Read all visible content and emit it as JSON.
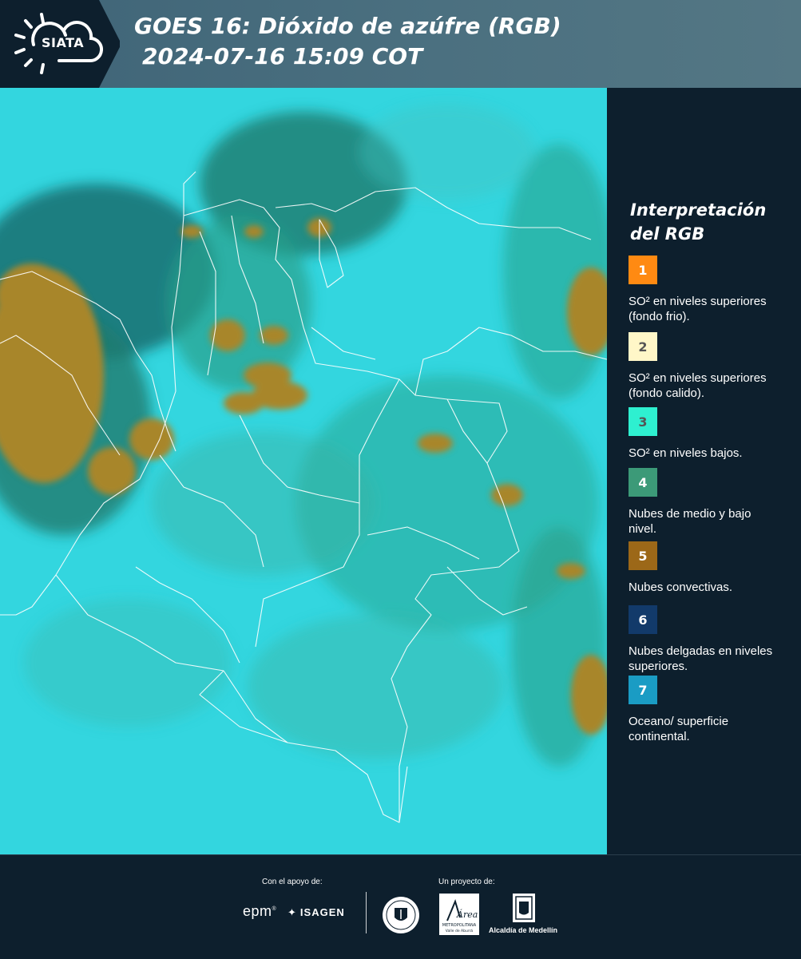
{
  "header": {
    "logo_text": "SIATA",
    "title_line1": "GOES 16: Dióxido de azúfre (RGB)",
    "title_line2": "2024-07-16 15:09 COT"
  },
  "map": {
    "base_color": "#33d6df",
    "landcover_color": "#3aa99a",
    "convective_color": "#a8862a",
    "border_color": "#ffffff"
  },
  "legend": {
    "title": "Interpretación del RGB",
    "items": [
      {
        "number": "1",
        "label": "SO² en niveles superiores (fondo frio).",
        "color": "#ff8a12",
        "text_color": "#ffffff"
      },
      {
        "number": "2",
        "label": "SO² en niveles superiores (fondo calido).",
        "color": "#fff7c8",
        "text_color": "#555555"
      },
      {
        "number": "3",
        "label": "SO² en niveles bajos.",
        "color": "#2ef0d0",
        "text_color": "#555555"
      },
      {
        "number": "4",
        "label": "Nubes de medio y bajo nivel.",
        "color": "#3c9a78",
        "text_color": "#ffffff"
      },
      {
        "number": "5",
        "label": "Nubes convectivas.",
        "color": "#9c6818",
        "text_color": "#ffffff"
      },
      {
        "number": "6",
        "label": "Nubes delgadas en niveles superiores.",
        "color": "#123a6a",
        "text_color": "#ffffff"
      },
      {
        "number": "7",
        "label": "Oceano/ superficie continental.",
        "color": "#1a9cc4",
        "text_color": "#ffffff"
      }
    ]
  },
  "footer": {
    "support_label": "Con el apoyo de:",
    "project_label": "Un proyecto de:",
    "epm": "epm",
    "isagen": "ISAGEN",
    "area_label": "Área",
    "area_sub1": "METROPOLITANA",
    "area_sub2": "Valle de Aburrá",
    "alcaldia": "Alcaldía de Medellín"
  }
}
